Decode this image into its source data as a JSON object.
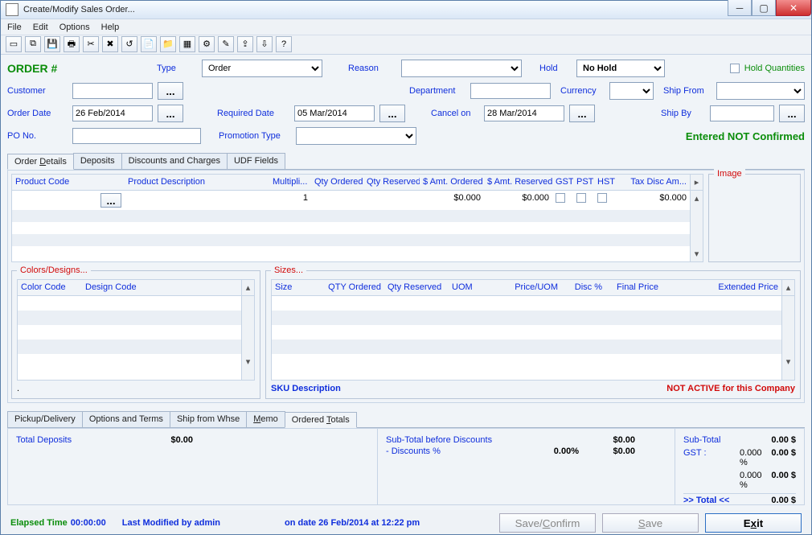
{
  "window": {
    "title": "Create/Modify Sales Order..."
  },
  "menu": {
    "file": "File",
    "edit": "Edit",
    "options": "Options",
    "help": "Help"
  },
  "header": {
    "order_label": "ORDER #",
    "type_label": "Type",
    "type_value": "Order",
    "reason_label": "Reason",
    "reason_value": "",
    "hold_label": "Hold",
    "hold_value": "No Hold",
    "hold_qty_label": "Hold Quantities",
    "customer_label": "Customer",
    "customer_value": "",
    "department_label": "Department",
    "currency_label": "Currency",
    "ship_from_label": "Ship From",
    "order_date_label": "Order Date",
    "order_date_value": "26 Feb/2014",
    "required_date_label": "Required Date",
    "required_date_value": "05 Mar/2014",
    "cancel_on_label": "Cancel on",
    "cancel_on_value": "28 Mar/2014",
    "ship_by_label": "Ship By",
    "po_no_label": "PO No.",
    "promotion_type_label": "Promotion Type",
    "status": "Entered NOT Confirmed"
  },
  "tabs_upper": {
    "order_details": "Order Details",
    "deposits": "Deposits",
    "discounts": "Discounts and Charges",
    "udf": "UDF Fields"
  },
  "product_grid": {
    "cols": {
      "code": "Product Code",
      "desc": "Product Description",
      "multi": "Multipli...",
      "qty_ord": "Qty Ordered",
      "qty_res": "Qty Reserved",
      "amt_ord": "$ Amt. Ordered",
      "amt_res": "$ Amt. Reserved",
      "gst": "GST",
      "pst": "PST",
      "hst": "HST",
      "tax_disc": "Tax Disc Am..."
    },
    "row1": {
      "multi": "1",
      "amt_ord": "$0.000",
      "amt_res": "$0.000",
      "tax_disc": "$0.000"
    },
    "image_label": "Image"
  },
  "colors": {
    "legend": "Colors/Designs...",
    "col_color": "Color Code",
    "col_design": "Design Code",
    "dash": "."
  },
  "sizes": {
    "legend": "Sizes...",
    "col_size": "Size",
    "col_qty_ord": "QTY Ordered",
    "col_qty_res": "Qty Reserved",
    "col_uom": "UOM",
    "col_price": "Price/UOM",
    "col_disc": "Disc %",
    "col_final": "Final Price",
    "col_ext": "Extended Price",
    "sku_desc": "SKU Description",
    "warn": "NOT ACTIVE for this Company"
  },
  "tabs_lower": {
    "pickup": "Pickup/Delivery",
    "opts": "Options and Terms",
    "ship": "Ship from Whse",
    "memo": "Memo",
    "totals": "Ordered Totals"
  },
  "totals": {
    "total_deposits_label": "Total Deposits",
    "total_deposits": "$0.00",
    "subtotal_before_label": "Sub-Total before Discounts",
    "subtotal_before": "$0.00",
    "discounts_label": "- Discounts %",
    "discounts_pct": "0.00%",
    "discounts_amt": "$0.00",
    "subtotal_label": "Sub-Total",
    "subtotal": "0.00 $",
    "gst_label": "GST :",
    "gst_pct": "0.000 %",
    "gst_amt": "0.00 $",
    "line2_pct": "0.000 %",
    "line2_amt": "0.00 $",
    "grand_total_label": ">> Total <<",
    "grand_total": "0.00 $"
  },
  "actions": {
    "save_confirm": "Save/Confirm",
    "save": "Save",
    "exit": "Exit"
  },
  "status": {
    "elapsed_label": "Elapsed Time",
    "elapsed": "00:00:00",
    "last_mod": "Last Modified by admin",
    "on_date": "on date 26 Feb/2014 at 12:22 pm"
  }
}
